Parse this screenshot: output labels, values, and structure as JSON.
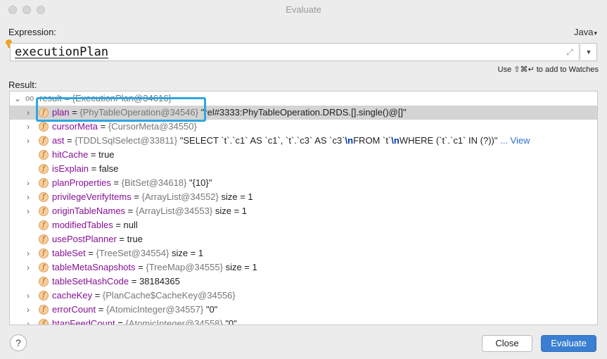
{
  "window": {
    "title": "Evaluate"
  },
  "expression": {
    "label": "Expression:",
    "language": "Java",
    "value": "executionPlan",
    "hint": "Use ⇧⌘↵ to add to Watches"
  },
  "result": {
    "label": "Result:",
    "root": {
      "name": "result",
      "type": "{ExecutionPlan@34616}"
    },
    "rows": [
      {
        "name": "plan",
        "type": "{PhyTableOperation@34546}",
        "value": "\"rel#3333:PhyTableOperation.DRDS.[].single()@[]\"",
        "expandable": true,
        "selected": true
      },
      {
        "name": "cursorMeta",
        "type": "{CursorMeta@34550}",
        "value": "",
        "expandable": true
      },
      {
        "name": "ast",
        "type": "{TDDLSqlSelect@33811}",
        "value_parts": [
          "\"SELECT `t`.`c1` AS `c1`, `t`.`c3` AS `c3`",
          "\\n",
          "FROM `t`",
          "\\n",
          "WHERE (`t`.`c1` IN (?))\""
        ],
        "link": "... View",
        "expandable": true
      },
      {
        "name": "hitCache",
        "type": "",
        "value": "true",
        "expandable": false
      },
      {
        "name": "isExplain",
        "type": "",
        "value": "false",
        "expandable": false
      },
      {
        "name": "planProperties",
        "type": "{BitSet@34618}",
        "value": "\"{10}\"",
        "expandable": true
      },
      {
        "name": "privilegeVerifyItems",
        "type": "{ArrayList@34552}",
        "value": "size = 1",
        "expandable": true
      },
      {
        "name": "originTableNames",
        "type": "{ArrayList@34553}",
        "value": "size = 1",
        "expandable": true
      },
      {
        "name": "modifiedTables",
        "type": "",
        "value": "null",
        "expandable": false
      },
      {
        "name": "usePostPlanner",
        "type": "",
        "value": "true",
        "expandable": false
      },
      {
        "name": "tableSet",
        "type": "{TreeSet@34554}",
        "value": "size = 1",
        "expandable": true
      },
      {
        "name": "tableMetaSnapshots",
        "type": "{TreeMap@34555}",
        "value": "size = 1",
        "expandable": true
      },
      {
        "name": "tableSetHashCode",
        "type": "",
        "value": "38184365",
        "expandable": false
      },
      {
        "name": "cacheKey",
        "type": "{PlanCache$CacheKey@34556}",
        "value": "",
        "expandable": true
      },
      {
        "name": "errorCount",
        "type": "{AtomicInteger@34557}",
        "value": "\"0\"",
        "expandable": true
      },
      {
        "name": "htapFeedCount",
        "type": "{AtomicInteger@34558}",
        "value": "\"0\"",
        "expandable": true
      }
    ]
  },
  "footer": {
    "help": "?",
    "close_label": "Close",
    "evaluate_label": "Evaluate"
  },
  "colors": {
    "accent": "#3a7fd1",
    "highlight": "#2ea7e0",
    "field_name": "#871094"
  }
}
